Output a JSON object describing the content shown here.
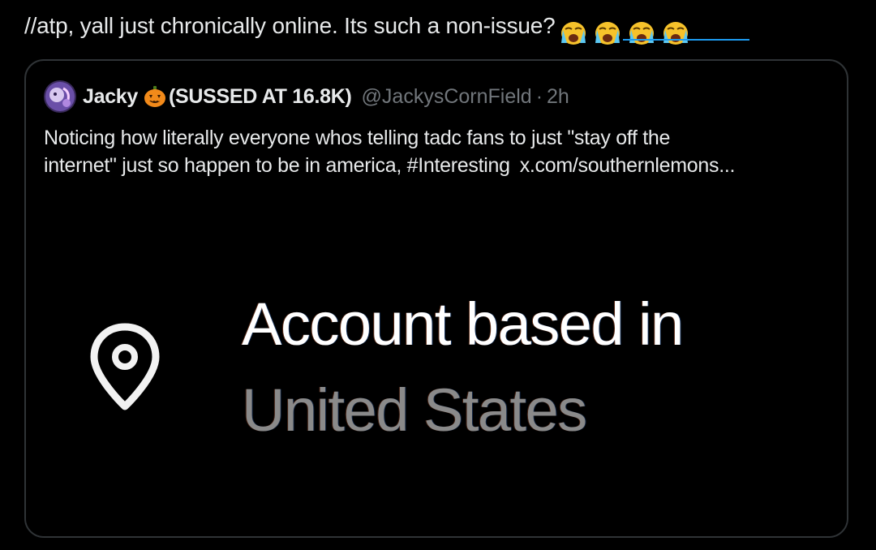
{
  "post": {
    "text": "//atp, yall just chronically online. Its such a non-issue?",
    "emojis": [
      "loudly-crying-face",
      "loudly-crying-face",
      "loudly-crying-face",
      "loudly-crying-face"
    ]
  },
  "quote": {
    "display_name": "Jacky",
    "name_emoji": "jack-o-lantern",
    "name_suffix": "(SUSSED AT 16.8K)",
    "handle": "@JackysCornField",
    "separator": "·",
    "time": "2h",
    "text_line1": "Noticing how literally everyone whos telling tadc fans to just \"stay off the",
    "text_line2": "internet\" just so happen to be in america, #Interesting",
    "link": "x.com/southernlemons...",
    "media": {
      "icon": "location-pin-icon",
      "line1": "Account based in",
      "line2": "United States"
    }
  },
  "colors": {
    "background": "#000000",
    "text": "#e7e9ea",
    "muted": "#71767b",
    "border": "#2f3336",
    "link_underline": "#1d9bf0"
  }
}
